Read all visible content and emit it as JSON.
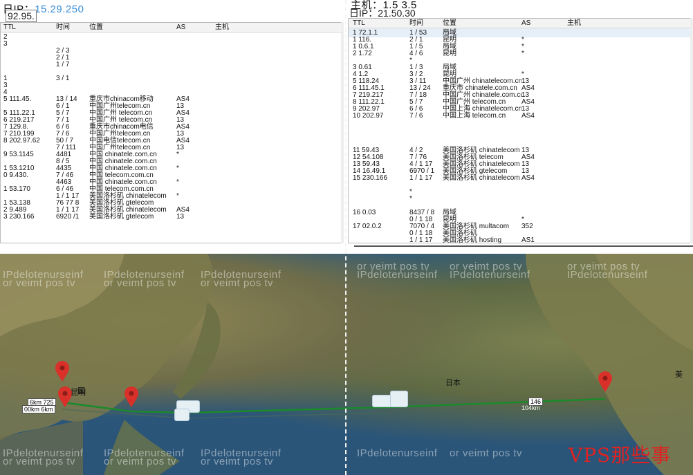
{
  "left_panel": {
    "title_prefix": "日IP：",
    "title_value": "15.29.250",
    "subtitle": "92.95.",
    "columns": [
      "ΤΤL",
      "时间",
      "位置",
      "AS",
      "主机"
    ],
    "rows": [
      [
        "2",
        "",
        "",
        "",
        ""
      ],
      [
        "3",
        "",
        "",
        "",
        ""
      ],
      [
        "",
        "2 / 3",
        "",
        "",
        ""
      ],
      [
        "",
        "2 / 1",
        "",
        "",
        ""
      ],
      [
        "",
        "1 / 7",
        "",
        "",
        ""
      ],
      [
        "",
        "",
        "",
        "",
        ""
      ],
      [
        "1",
        "3 / 1",
        "",
        "",
        ""
      ],
      [
        "3",
        "",
        "",
        "",
        ""
      ],
      [
        "4",
        "",
        "",
        "",
        ""
      ],
      [
        "5   111.45.",
        "13 / 14",
        "重庆市chinacom移动",
        "AS4",
        ""
      ],
      [
        "",
        "6 / 1",
        "中国广州telecom.cn",
        "13",
        ""
      ],
      [
        "5   111.22.1",
        "5 / 7",
        "中国广州 telecom.cn",
        "AS4",
        ""
      ],
      [
        "6   219.217",
        "7 / 1",
        "中国广州 telecom.cn",
        "13",
        ""
      ],
      [
        "7   129.8.",
        "6 / 6",
        "重庆市chinacom电信",
        "AS4",
        ""
      ],
      [
        "7   210.199",
        "7 / 6",
        "中国广州telecom.cn",
        "13",
        ""
      ],
      [
        "8   202.97.62",
        "50 / 7",
        "中国电信telecom.cn",
        "AS4",
        ""
      ],
      [
        "",
        "7 / 111",
        "中国广州telecom.cn",
        "13",
        ""
      ],
      [
        "9   53.1145",
        "4481",
        "中国 chinatele.com.cn",
        "*",
        ""
      ],
      [
        "",
        "8 / 5",
        "中国 chinatele.com.cn",
        "",
        ""
      ],
      [
        "1   53.1210",
        "4435",
        "中国 chinatele.com.cn",
        "*",
        ""
      ],
      [
        "0   9.430.",
        "7 / 46",
        "中国 telecom.com.cn",
        "",
        ""
      ],
      [
        "",
        "4463",
        "中国 chinatele.com.cn",
        "*",
        ""
      ],
      [
        "1   53.170",
        "6 / 46",
        "中国 telecom.com.cn",
        "",
        ""
      ],
      [
        "",
        "1 / 1 17",
        "美国洛杉矶 chinatelecom",
        "*",
        ""
      ],
      [
        "1   53.138",
        "76 77 8",
        "美国洛杉矶 gtelecom",
        "",
        ""
      ],
      [
        "2   9.489",
        "1 / 1 17",
        "美国洛杉矶 chinatelecom",
        "AS4",
        ""
      ],
      [
        "3   230.166",
        "6920 /1",
        "美国洛杉矶 gtelecom",
        "13",
        ""
      ],
      [
        "",
        "",
        "",
        "",
        ""
      ],
      [
        "",
        "",
        "",
        "",
        ""
      ],
      [
        "",
        "",
        "",
        "",
        ""
      ],
      [
        "",
        "",
        "",
        "",
        ""
      ],
      [
        "",
        "",
        "",
        "",
        ""
      ]
    ]
  },
  "right_panel": {
    "title_prefix": "主机：",
    "title_value": "1.5 3.5",
    "subtitle": "日IP：21.50.30",
    "columns": [
      "ΤΤL",
      "时间",
      "位置",
      "AS",
      "主机"
    ],
    "rows": [
      [
        "1   72.1.1",
        "1 / 53",
        "局域",
        "",
        ""
      ],
      [
        "1   116.",
        "2 / 1",
        "昆明",
        "*",
        ""
      ],
      [
        "1   0.6.1",
        "1 / 5",
        "局域",
        "*",
        ""
      ],
      [
        "2   1.72",
        "4 / 6",
        "昆明",
        "*",
        ""
      ],
      [
        "",
        "*",
        "",
        "",
        ""
      ],
      [
        "3   0.61",
        "1 / 3",
        "局域",
        "",
        ""
      ],
      [
        "4   1.2",
        "3 / 2",
        "昆明",
        "*",
        ""
      ],
      [
        "5   118.24",
        "3 / 11",
        "中国广州 chinatelecom.cn",
        "13",
        ""
      ],
      [
        "6   111.45.1",
        "13 / 24",
        "重庆市 chinatele.com.cn",
        "AS4",
        ""
      ],
      [
        "7   219.217",
        "7 / 18",
        "中国广州 chinatele.com.cn",
        "13",
        ""
      ],
      [
        "8   111.22.1",
        "5 / 7",
        "中国广州 telecom.cn",
        "AS4",
        ""
      ],
      [
        "9   202.97",
        "6 / 6",
        "中国上海 chinatelecom.cn",
        "13",
        ""
      ],
      [
        "10  202.97",
        "7 / 6",
        "中国上海 telecom.cn",
        "AS4",
        ""
      ],
      [
        "",
        "",
        "",
        "",
        ""
      ],
      [
        "",
        "",
        "",
        "",
        ""
      ],
      [
        "",
        "",
        "",
        "",
        ""
      ],
      [
        "",
        "",
        "",
        "",
        ""
      ],
      [
        "11  59.43",
        "4 / 2",
        "美国洛杉矶 chinatelecom",
        "13",
        ""
      ],
      [
        "12  54.108",
        "7 / 76",
        "美国洛杉矶 telecom",
        "AS4",
        ""
      ],
      [
        "13  59.43",
        "4 / 1 17",
        "美国洛杉矶 chinatelecom",
        "13",
        ""
      ],
      [
        "14  16.49.1",
        "6970 / 1",
        "美国洛杉矶 gtelecom",
        "13",
        ""
      ],
      [
        "15  230.166",
        "1 / 1 17",
        "美国洛杉矶 chinatelecom",
        "AS4",
        ""
      ],
      [
        "",
        "",
        "",
        "",
        ""
      ],
      [
        "",
        "*",
        "",
        "",
        ""
      ],
      [
        "",
        "*",
        "",
        "",
        ""
      ],
      [
        "",
        "",
        "",
        "",
        ""
      ],
      [
        "16  0.03",
        "8437 / 8",
        "局域",
        "",
        ""
      ],
      [
        "",
        "0 / 1 18",
        "昆明",
        "*",
        ""
      ],
      [
        "17  02.0.2",
        "7070 / 4",
        "美国洛杉矶 multacom",
        "352",
        ""
      ],
      [
        "",
        "0 / 1 18",
        "美国洛杉矶",
        "",
        ""
      ],
      [
        "",
        "1 / 1 17",
        "美国洛杉矶 hosting",
        "AS1",
        ""
      ]
    ]
  },
  "map": {
    "watermark_a": "IPdelotenurseinf",
    "watermark_b": "or veimt pos tv",
    "labels": {
      "kunming": "昆明",
      "china": "国",
      "japan": "日本",
      "usa": "美",
      "dist1": "6km 725",
      "dist2": "00km 6km",
      "dist3": "146",
      "dist4": "104km"
    },
    "brand": "VPS那些事",
    "route_color": "#1a8a2a",
    "pin_color": "#d9302a"
  }
}
